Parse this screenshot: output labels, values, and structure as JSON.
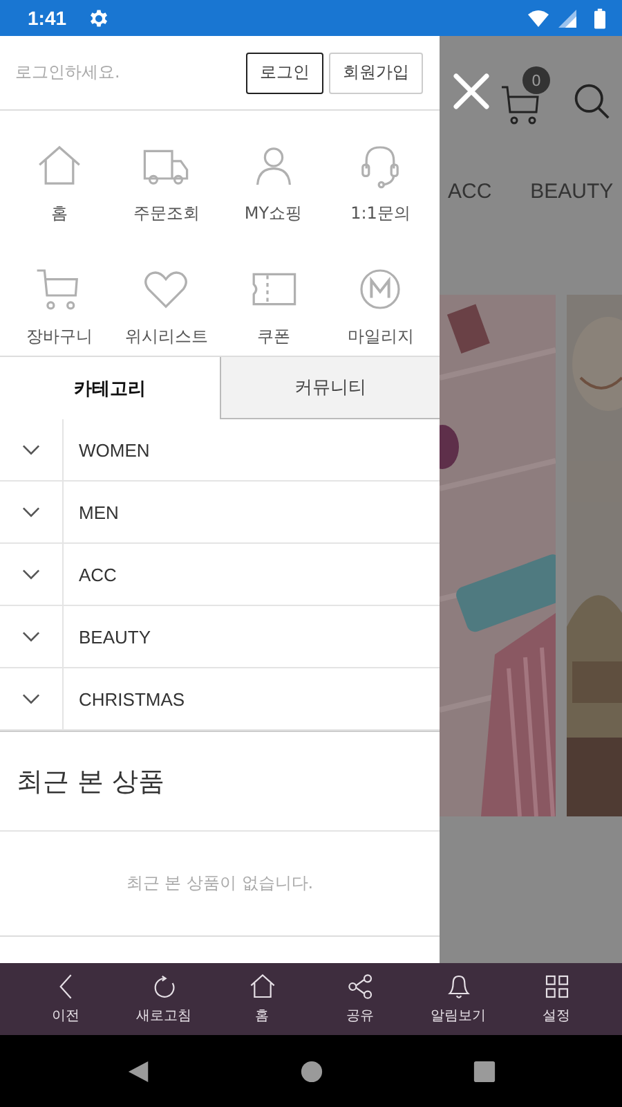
{
  "status_bar": {
    "time": "1:41"
  },
  "drawer": {
    "login_prompt": "로그인하세요.",
    "buttons": [
      {
        "label": "로그인",
        "kind": "primary"
      },
      {
        "label": "회원가입",
        "kind": "secondary"
      }
    ],
    "shortcuts": [
      {
        "label": "홈",
        "kind": "home"
      },
      {
        "label": "주문조회",
        "kind": "truck"
      },
      {
        "label": "MY쇼핑",
        "kind": "person"
      },
      {
        "label": "1:1문의",
        "kind": "headset"
      },
      {
        "label": "장바구니",
        "kind": "cart"
      },
      {
        "label": "위시리스트",
        "kind": "heart"
      },
      {
        "label": "쿠폰",
        "kind": "coupon"
      },
      {
        "label": "마일리지",
        "kind": "mileage"
      }
    ],
    "tabs": [
      {
        "label": "카테고리",
        "selected": true
      },
      {
        "label": "커뮤니티",
        "selected": false
      }
    ],
    "categories": [
      {
        "label": "WOMEN",
        "expanded": false
      },
      {
        "label": "MEN",
        "expanded": false
      },
      {
        "label": "ACC",
        "expanded": false
      },
      {
        "label": "BEAUTY",
        "expanded": false
      },
      {
        "label": "CHRISTMAS",
        "expanded": false
      }
    ],
    "recent": {
      "title": "최근 본 상품",
      "empty_message": "최근 본 상품이 없습니다."
    }
  },
  "background_page": {
    "cart_count": "0",
    "tabs": [
      "ACC",
      "BEAUTY"
    ]
  },
  "bottom_nav": [
    {
      "label": "이전",
      "kind": "back"
    },
    {
      "label": "새로고침",
      "kind": "refresh"
    },
    {
      "label": "홈",
      "kind": "home"
    },
    {
      "label": "공유",
      "kind": "share"
    },
    {
      "label": "알림보기",
      "kind": "bell"
    },
    {
      "label": "설정",
      "kind": "grid"
    }
  ]
}
